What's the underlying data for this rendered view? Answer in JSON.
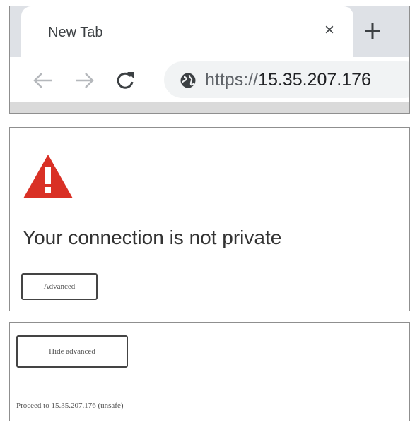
{
  "browser": {
    "tab": {
      "title": "New Tab",
      "close_glyph": "×"
    },
    "new_tab_glyph": "+",
    "address": {
      "scheme": "https://",
      "host": "15.35.207.176"
    },
    "icons": {
      "back": "back-arrow-icon",
      "forward": "forward-arrow-icon",
      "reload": "reload-icon",
      "site_info": "globe-icon",
      "new_tab": "plus-icon"
    }
  },
  "error_page": {
    "warning_icon": "warning-triangle-icon",
    "warning_color": "#d93025",
    "heading": "Your connection is not private",
    "advanced_button": "Advanced"
  },
  "advanced_panel": {
    "hide_button": "Hide advanced",
    "proceed_link": "Proceed to 15.35.207.176 (unsafe)"
  }
}
